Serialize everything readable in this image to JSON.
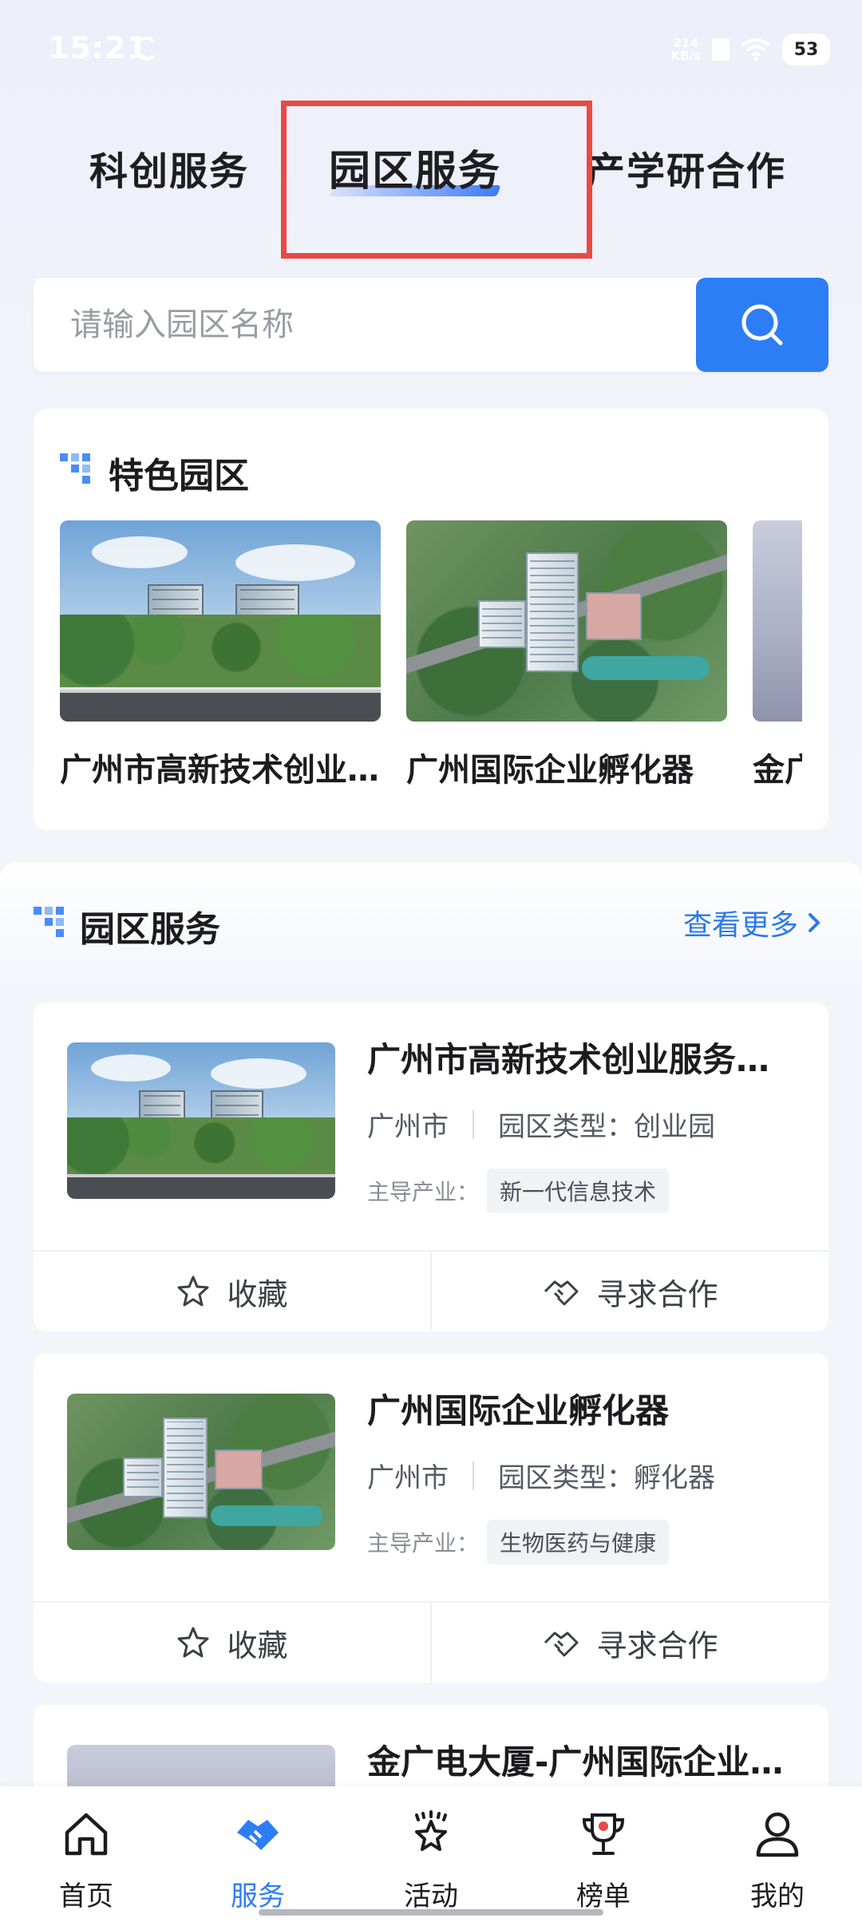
{
  "status_bar": {
    "time": "15:21",
    "net_speed_value": "214",
    "net_speed_unit": "KB/s",
    "battery": "53"
  },
  "top_tabs": [
    {
      "label": "科创服务"
    },
    {
      "label": "园区服务"
    },
    {
      "label": "产学研合作"
    }
  ],
  "active_tab": "园区服务",
  "search": {
    "placeholder": "请输入园区名称"
  },
  "featured": {
    "title": "特色园区",
    "items": [
      {
        "name": "广州市高新技术创业服务中心"
      },
      {
        "name": "广州国际企业孵化器"
      },
      {
        "name": "金广电大厦"
      }
    ]
  },
  "park_service": {
    "title": "园区服务",
    "view_more": "查看更多",
    "cards": [
      {
        "name": "广州市高新技术创业服务中心",
        "city": "广州市",
        "type_label": "园区类型：",
        "type": "创业园",
        "industry_label": "主导产业：",
        "industry": "新一代信息技术",
        "fav_label": "收藏",
        "coop_label": "寻求合作"
      },
      {
        "name": "广州国际企业孵化器",
        "city": "广州市",
        "type_label": "园区类型：",
        "type": "孵化器",
        "industry_label": "主导产业：",
        "industry": "生物医药与健康",
        "fav_label": "收藏",
        "coop_label": "寻求合作"
      },
      {
        "name": "金广电大厦-广州国际企业孵化器"
      }
    ]
  },
  "bottom_nav": [
    {
      "label": "首页"
    },
    {
      "label": "服务"
    },
    {
      "label": "活动"
    },
    {
      "label": "榜单"
    },
    {
      "label": "我的"
    }
  ],
  "active_nav": "服务",
  "colors": {
    "accent": "#2d7df6",
    "highlight": "#e84a44",
    "link": "#2b7ae8"
  }
}
